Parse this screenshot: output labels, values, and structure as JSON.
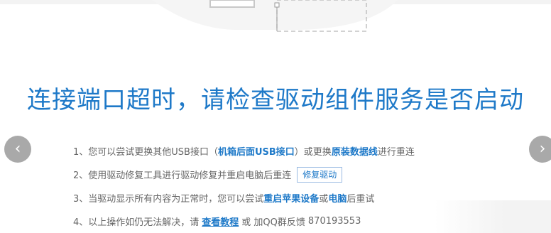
{
  "headline": "连接端口超时，请检查驱动组件服务是否启动",
  "nav": {
    "prev_icon": "chevron-left-icon",
    "next_icon": "chevron-right-icon",
    "prev_glyph": "‹",
    "next_glyph": "›"
  },
  "steps": [
    {
      "prefix": "1、您可以尝试更换其他USB接口（",
      "link1": "机箱后面USB接口",
      "middle": "）或更换",
      "link2": "原装数据线",
      "suffix": "进行重连"
    },
    {
      "text": "2、使用驱动修复工具进行驱动修复并重启电脑后重连",
      "button": "修复驱动"
    },
    {
      "prefix": "3、当驱动显示所有内容为正常时，您可以尝试",
      "link1": "重启苹果设备",
      "middle": "或",
      "link2": "电脑",
      "suffix": "后重试"
    },
    {
      "prefix": "4、以上操作如仍无法解决，请",
      "link": "查看教程",
      "middle": "或 加QQ群反馈",
      "number": "870193553"
    }
  ],
  "colors": {
    "accent": "#1e79c8",
    "text": "#666666",
    "nav_bg": "#a9a9a9"
  }
}
